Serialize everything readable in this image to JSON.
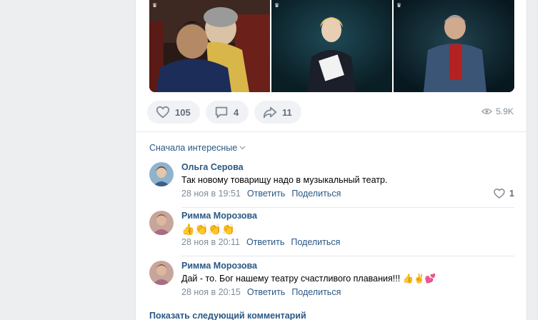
{
  "post": {
    "photos": [
      {
        "name": "photo-couple",
        "badge": "VK"
      },
      {
        "name": "photo-woman-speaker",
        "badge": "VK"
      },
      {
        "name": "photo-man-red-shirt",
        "badge": "VK"
      }
    ],
    "actions": {
      "likes": "105",
      "comments": "4",
      "shares": "11",
      "views": "5.9K"
    },
    "sort_label": "Сначала интересные",
    "comments": [
      {
        "author": "Ольга Серова",
        "text": "Так новому товарищу надо в музыкальный театр.",
        "date": "28 ноя в 19:51",
        "reply": "Ответить",
        "share": "Поделиться",
        "likes": "1"
      },
      {
        "author": "Римма Морозова",
        "text": "👍👏👏👏",
        "date": "28 ноя в 20:11",
        "reply": "Ответить",
        "share": "Поделиться",
        "likes": ""
      },
      {
        "author": "Римма Морозова",
        "text": "Дай - то. Бог нашему театру счастливого плавания!!! 👍✌💕",
        "date": "28 ноя в 20:15",
        "reply": "Ответить",
        "share": "Поделиться",
        "likes": ""
      }
    ],
    "show_more": "Показать следующий комментарий"
  },
  "colors": {
    "link": "#2a5885",
    "muted": "#818c99",
    "button_bg": "#f0f2f5",
    "page_bg": "#edeef0"
  }
}
